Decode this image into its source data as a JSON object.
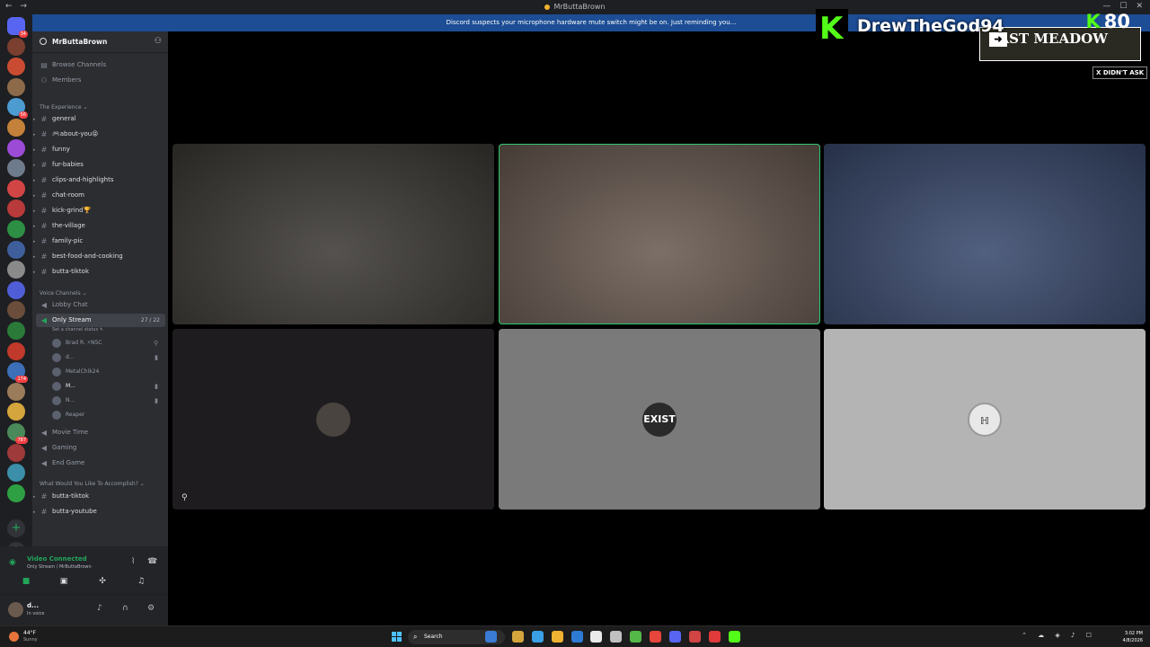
{
  "window": {
    "title": "MrButtaBrown"
  },
  "notice": "Discord suspects your microphone hardware mute switch might be on. Just reminding you...",
  "guild_bar": {
    "icons": [
      {
        "color": "#5865f2",
        "badge": "34"
      },
      {
        "color": "#7a3f2f",
        "badge": ""
      },
      {
        "color": "#c94c32",
        "badge": ""
      },
      {
        "color": "#8d6b4a",
        "badge": ""
      },
      {
        "color": "#4c9bd1",
        "badge": "56"
      },
      {
        "color": "#c3813a",
        "badge": ""
      },
      {
        "color": "#9c4bd6",
        "badge": ""
      },
      {
        "color": "#6d7b8c",
        "badge": ""
      },
      {
        "color": "#d24545",
        "badge": ""
      },
      {
        "color": "#b83a3a",
        "badge": ""
      },
      {
        "color": "#2c8f43",
        "badge": ""
      },
      {
        "color": "#3f5f9c",
        "badge": ""
      },
      {
        "color": "#8a8a8a",
        "badge": ""
      },
      {
        "color": "#4f5ed6",
        "badge": ""
      },
      {
        "color": "#6a4d3a",
        "badge": ""
      },
      {
        "color": "#2b7a3a",
        "badge": ""
      },
      {
        "color": "#c0392b",
        "badge": ""
      },
      {
        "color": "#3d6fb8",
        "badge": "174"
      },
      {
        "color": "#9a7c5a",
        "badge": ""
      },
      {
        "color": "#d4a53c",
        "badge": ""
      },
      {
        "color": "#4a8a5a",
        "badge": "787"
      },
      {
        "color": "#9e3a3a",
        "badge": ""
      },
      {
        "color": "#3b8fa8",
        "badge": ""
      },
      {
        "color": "#2ea043",
        "badge": ""
      }
    ]
  },
  "channels": {
    "server_name": "MrButtaBrown",
    "browse": "Browse Channels",
    "members": "Members",
    "cat_experience": "The Experience",
    "text1": [
      "general",
      "🎮about-you😝",
      "funny",
      "fur-babies",
      "clips-and-highlights",
      "chat-room",
      "kick-grind🏆",
      "the-village",
      "family-pic",
      "best-food-and-cooking",
      "butta-tiktok"
    ],
    "cat_voice": "Voice Channels",
    "lobby": "Lobby Chat",
    "only_stream": "Only Stream",
    "only_stream_count": "27 / 22",
    "status_hint": "Set a channel status",
    "voice_users": [
      "Brad R. ⚡NSC",
      "d...",
      "MetalChik24",
      "M...",
      "N...",
      "Reaper"
    ],
    "movie": "Movie Time",
    "gaming": "Gaming",
    "endgame": "End Game",
    "cat_accomplish": "What Would You Like To Accomplish?",
    "text2": [
      "butta-tiktok",
      "butta-youtube"
    ]
  },
  "voice_panel": {
    "status": "Video Connected",
    "sub": "Only Stream / MrButtaBrown"
  },
  "user_panel": {
    "name": "d...",
    "status": "In voice"
  },
  "tiles": [
    {
      "kind": "video",
      "bg": "#3d3a36"
    },
    {
      "kind": "video",
      "bg": "#6a5b52",
      "speaking": true
    },
    {
      "kind": "video",
      "bg": "#3a4a6e"
    },
    {
      "kind": "avatar",
      "bg": "#1f1c20",
      "avatar_bg": "#4a4440",
      "label": ""
    },
    {
      "kind": "avatar",
      "bg": "#7a7a7a",
      "avatar_bg": "#2a2a2a",
      "label": "EXIST"
    },
    {
      "kind": "avatar",
      "bg": "#b4b4b4",
      "avatar_bg": "#e8e8e8",
      "label": "ℍ"
    }
  ],
  "overlay": {
    "k_letter": "K",
    "streamer": "DrewTheGod94",
    "viewers": "80",
    "meadow": "LAST MEADOW",
    "ask": "X DIDN'T ASK"
  },
  "taskbar": {
    "temp": "44°F",
    "weather": "Sunny",
    "search": "Search",
    "time": "3:02 PM",
    "date": "4/8/2026",
    "apps": [
      "#3a7bd5",
      "#d4a53c",
      "#3aa0e8",
      "#f0b232",
      "#2e7bd6",
      "#eaeaea",
      "#c0c0c0",
      "#54b848",
      "#e8453c",
      "#5865f2",
      "#d24545",
      "#e23a3a",
      "#53fc18"
    ]
  }
}
